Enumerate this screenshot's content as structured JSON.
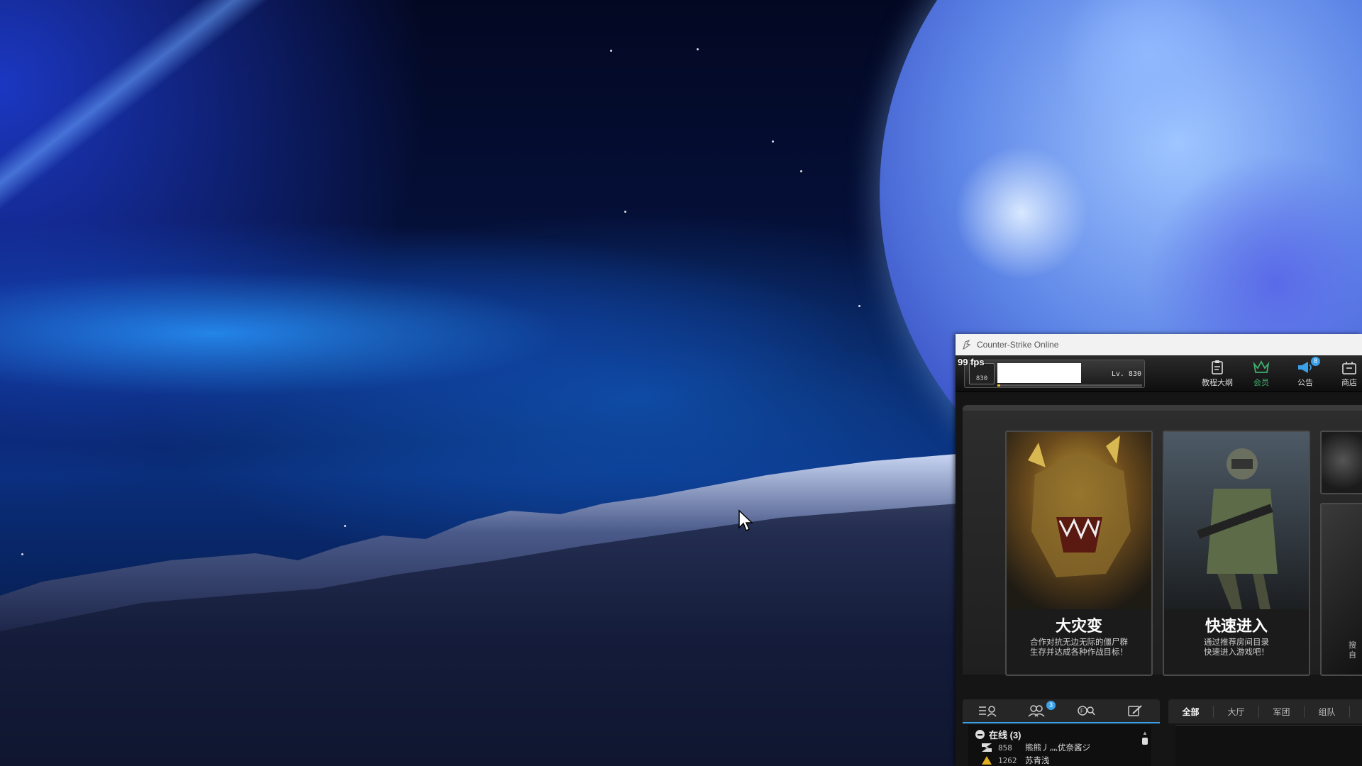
{
  "window": {
    "title": "Counter-Strike Online"
  },
  "hud": {
    "fps": "99 fps"
  },
  "profile": {
    "rank_number": "830",
    "level": "Lv. 830",
    "exp_fraction": 0.02
  },
  "topnav": [
    {
      "label": "教程大纲",
      "icon": "clipboard-icon"
    },
    {
      "label": "会员",
      "icon": "crown-icon",
      "active": true
    },
    {
      "label": "公告",
      "icon": "megaphone-icon",
      "badge": "8"
    },
    {
      "label": "商店",
      "icon": "store-icon"
    }
  ],
  "modes": [
    {
      "title": "大灾变",
      "desc1": "合作对抗无边无际的僵尸群",
      "desc2": "生存并达成各种作战目标！"
    },
    {
      "title": "快速进入",
      "desc1": "通过推荐房间目录",
      "desc2": "快速进入游戏吧！"
    }
  ],
  "partial_card": {
    "line1": "搜",
    "line2": "自"
  },
  "social": {
    "tabs": [
      {
        "icon": "list-user-icon"
      },
      {
        "icon": "friends-icon",
        "badge": "3"
      },
      {
        "icon": "clan-search-icon"
      },
      {
        "icon": "edit-icon"
      }
    ],
    "online_group": "在线 (3)",
    "friends": [
      {
        "level": "858",
        "name": "熊熊丿灬优奈酱ジ"
      },
      {
        "level": "1262",
        "name": "苏青浅"
      }
    ]
  },
  "chat": {
    "tabs": [
      "全部",
      "大厅",
      "军团",
      "组队"
    ],
    "active_tab": "全部"
  }
}
